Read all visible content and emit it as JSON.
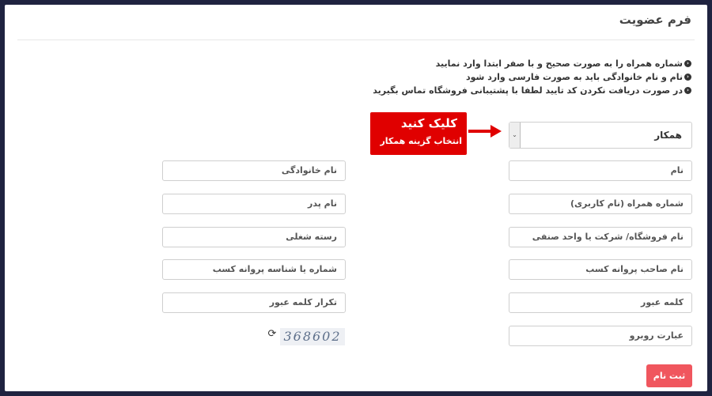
{
  "form": {
    "title": "فرم عضویت",
    "notes": [
      "شماره همراه را به صورت صحیح و با صفر ابتدا وارد نمایید",
      "نام و نام خانوادگی باید به صورت فارسی وارد شود",
      "در صورت دریافت نکردن کد تایید لطفا با پشتیبانی فروشگاه تماس بگیرید"
    ],
    "type_select": {
      "value": "همکار"
    },
    "callout": {
      "line1": "کلیک کنید",
      "line2": "انتخاب گزینه همکار"
    },
    "fields": {
      "first_name": "نام",
      "last_name": "نام خانوادگی",
      "mobile": "شماره همراه (نام کاربری)",
      "father_name": "نام پدر",
      "store_name": "نام فروشگاه/ شرکت یا واحد صنفی",
      "job_category": "رسته شغلی",
      "license_owner": "نام صاحب پروانه کسب",
      "license_number": "شماره یا شناسه پروانه کسب",
      "password": "کلمه عبور",
      "password_repeat": "تکرار کلمه عبور",
      "captcha_input": "عبارت روبرو"
    },
    "captcha_code": "368602",
    "submit_label": "ثبت نام"
  }
}
